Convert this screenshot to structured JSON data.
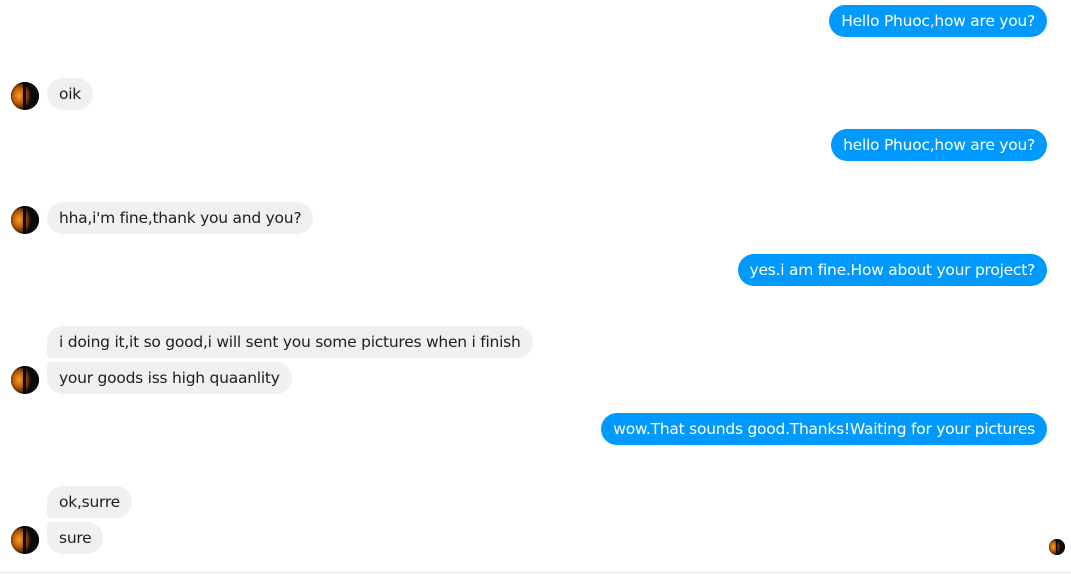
{
  "conversation": {
    "messages": [
      {
        "text": "Hello Phuoc,how are you?"
      },
      {
        "text": "oik"
      },
      {
        "text": "hello Phuoc,how are you?"
      },
      {
        "text": "hha,i'm fine,thank you and you?"
      },
      {
        "text": "yes.i am fine.How about your project?"
      },
      {
        "text": "i doing it,it so good,i will sent you some pictures when i finish"
      },
      {
        "text": "your goods iss high quaanlity"
      },
      {
        "text": "wow.That sounds good.Thanks!Waiting for your pictures"
      },
      {
        "text": "ok,surre"
      },
      {
        "text": "sure"
      }
    ]
  },
  "icons": {
    "avatar": "contact-avatar-icon",
    "seen": "seen-receipt-avatar-icon"
  },
  "colors": {
    "outgoing_bubble": "#0099ff",
    "outgoing_text": "#ffffff",
    "incoming_bubble": "#f0f0f0",
    "incoming_text": "#1c1e21"
  }
}
